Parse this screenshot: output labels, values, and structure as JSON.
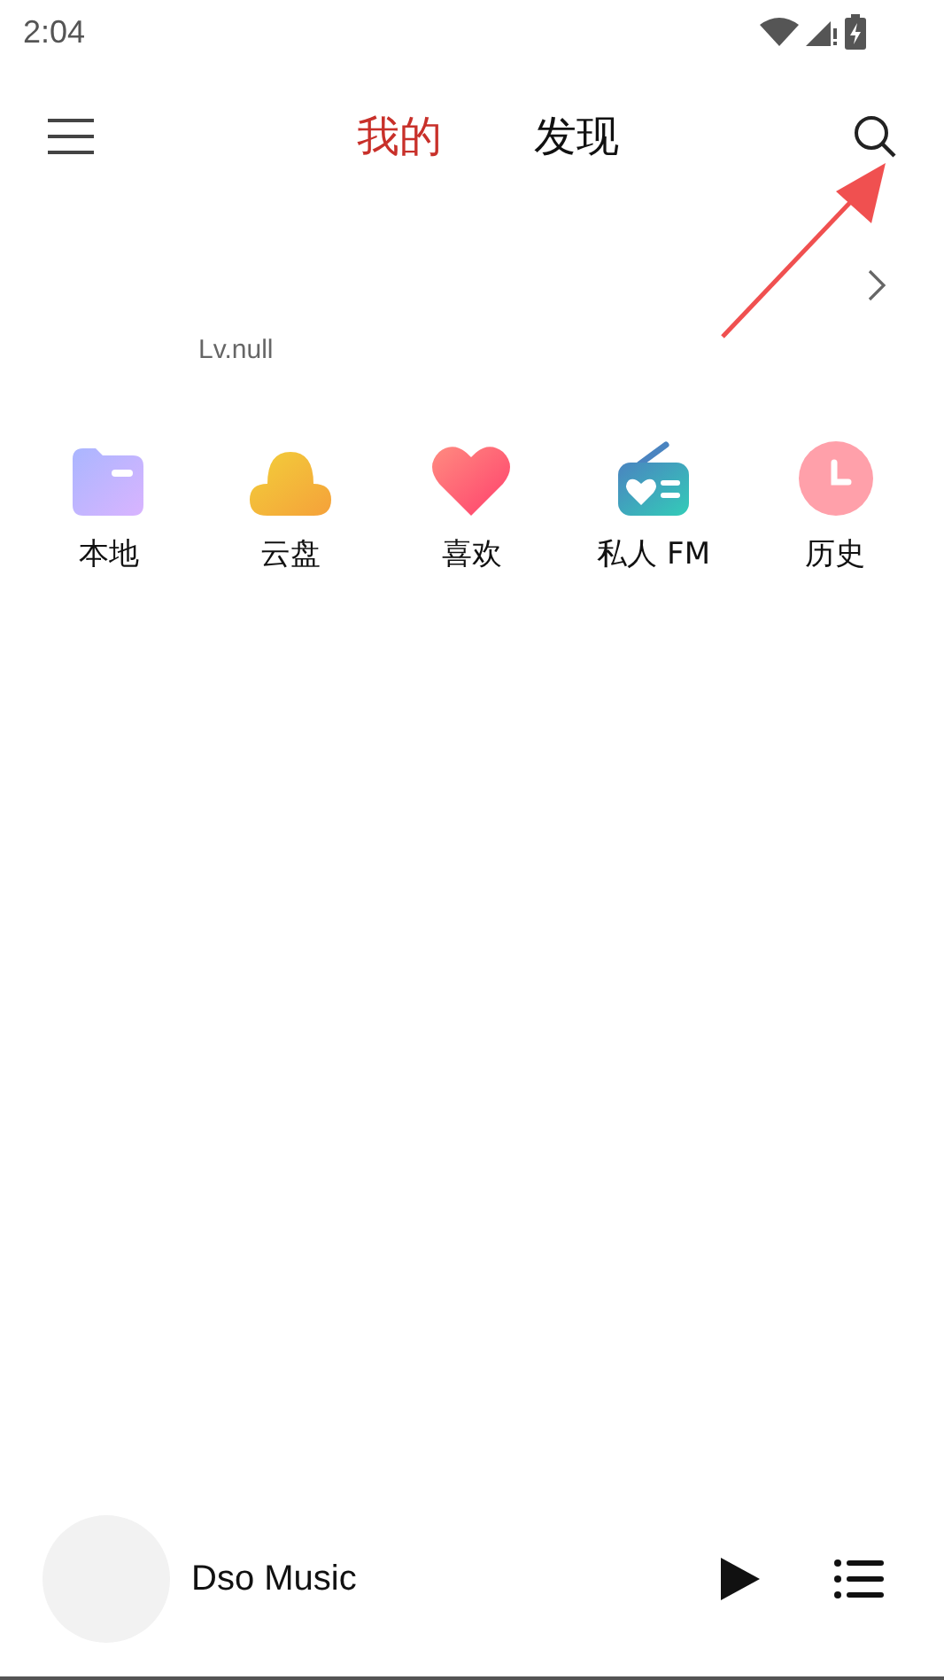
{
  "status_bar": {
    "time": "2:04"
  },
  "tabs": [
    {
      "label": "我的",
      "selected": true
    },
    {
      "label": "发现",
      "selected": false
    }
  ],
  "profile": {
    "level": "Lv.null"
  },
  "shortcuts": [
    {
      "kind": "folder",
      "label": "本地"
    },
    {
      "kind": "cloud",
      "label": "云盘"
    },
    {
      "kind": "heart",
      "label": "喜欢"
    },
    {
      "kind": "radio",
      "label": "私人 FM"
    },
    {
      "kind": "clock",
      "label": "历史"
    }
  ],
  "player": {
    "title": "Dso Music"
  }
}
